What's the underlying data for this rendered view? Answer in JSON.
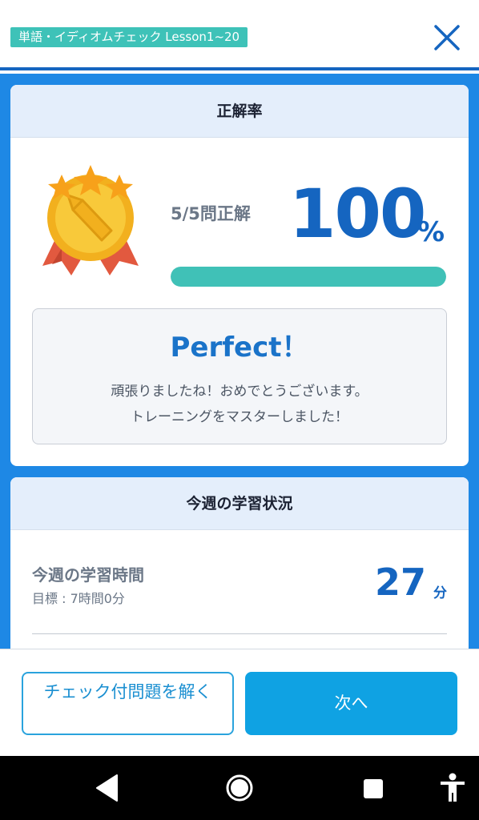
{
  "header": {
    "lesson_tag": "単語・イディオムチェック Lesson1~20",
    "close_icon": "close-icon"
  },
  "result": {
    "title": "正解率",
    "score_text": "5/5問正解",
    "percent_value": "100",
    "percent_sign": "%",
    "progress_fraction": 1.0,
    "medal_icon": "gold-medal-icon",
    "perfect_title": "Perfect！",
    "message_line1": "頑張りましたね！おめでとうございます。",
    "message_line2": "トレーニングをマスターしました！"
  },
  "weekly": {
    "title": "今週の学習状況",
    "study_time_label": "今週の学習時間",
    "goal_text": "目標 : 7時間0分",
    "study_time_value": "27",
    "study_time_unit": "分"
  },
  "actions": {
    "checked_button_label": "チェック付問題を解く",
    "next_button_label": "次へ"
  },
  "system_nav": {
    "back_icon": "back-icon",
    "home_icon": "home-icon",
    "recent_icon": "recent-apps-icon",
    "accessibility_icon": "accessibility-icon"
  },
  "colors": {
    "accent_blue": "#1565c0",
    "content_blue": "#1e88e5",
    "teal": "#3ec2b8",
    "button_blue": "#0fa2e3"
  }
}
